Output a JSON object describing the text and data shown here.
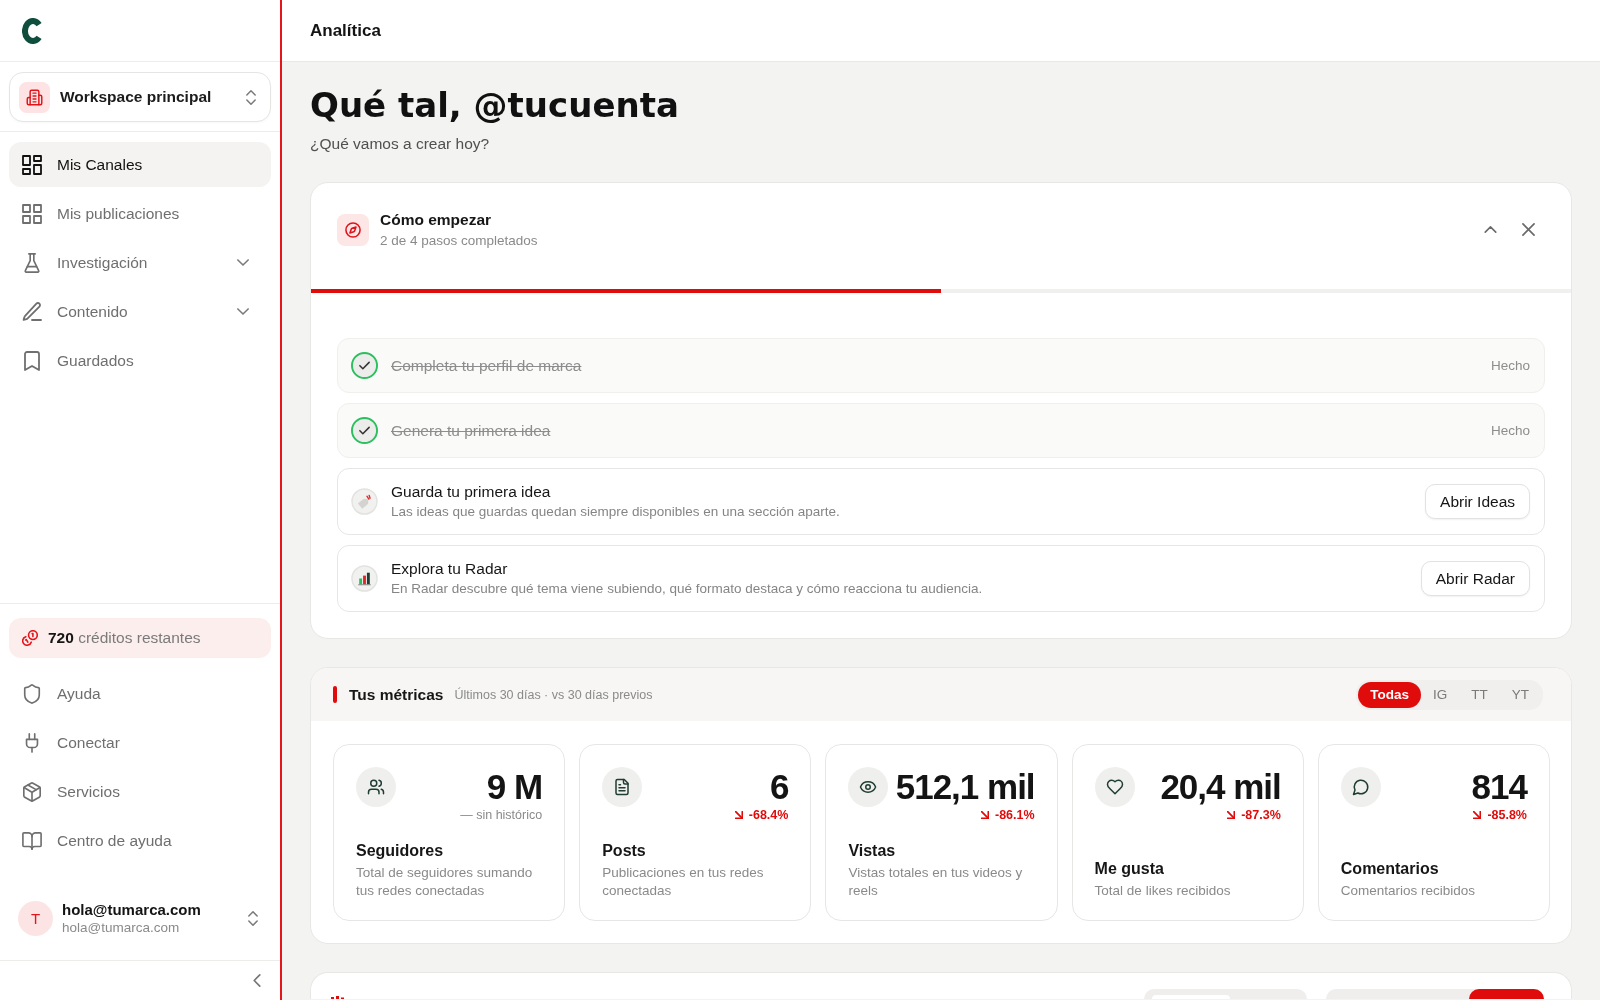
{
  "sidebar": {
    "workspace": {
      "name": "Workspace principal"
    },
    "nav": [
      {
        "label": "Mis Canales",
        "kind": "link",
        "selected": true
      },
      {
        "label": "Mis publicaciones",
        "kind": "link",
        "selected": false
      },
      {
        "label": "Investigación",
        "kind": "group",
        "selected": false,
        "expanded": false
      },
      {
        "label": "Contenido",
        "kind": "group",
        "selected": false,
        "expanded": false
      },
      {
        "label": "Guardados",
        "kind": "link",
        "selected": false
      }
    ],
    "credits": {
      "text": "**720** créditos restantes"
    },
    "footer_nav": [
      {
        "label": "Ayuda",
        "selected": false
      },
      {
        "label": "Conectar",
        "selected": false
      },
      {
        "label": "Servicios",
        "selected": false
      },
      {
        "label": "Centro de ayuda",
        "selected": false
      }
    ],
    "user": {
      "initial": "T",
      "name": "hola@tumarca.com",
      "email": "hola@tumarca.com"
    }
  },
  "header": {
    "title": "Analítica"
  },
  "greeting": {
    "title": "Qué tal, @tucuenta",
    "subtitle": "¿Qué vamos a crear hoy?"
  },
  "onboarding": {
    "title": "Cómo empezar",
    "progress_text": "2 de 4 pasos completados",
    "expanded": true,
    "level": 0.5,
    "steps": [
      {
        "title": "Completa tu perfil de marca",
        "done": true,
        "status": "Hecho"
      },
      {
        "title": "Genera tu primera idea",
        "done": true,
        "status": "Hecho"
      },
      {
        "title": "Guarda tu primera idea",
        "done": false,
        "description": "Las ideas que guardas quedan siempre disponibles en una sección aparte.",
        "action": "Abrir Ideas"
      },
      {
        "title": "Explora tu Radar",
        "done": false,
        "description": "En Radar descubre qué tema viene subiendo, qué formato destaca y cómo reacciona tu audiencia.",
        "action": "Abrir Radar"
      }
    ]
  },
  "metrics": {
    "title": "Tus métricas",
    "period": "Últimos 30 días · vs 30 días previos",
    "filters": [
      {
        "label": "Todas",
        "selected": true
      },
      {
        "label": "IG",
        "selected": false
      },
      {
        "label": "TT",
        "selected": false
      },
      {
        "label": "YT",
        "selected": false
      }
    ],
    "cards": [
      {
        "kind": "neutral",
        "value": "9 M",
        "change": "— sin histórico",
        "label": "Seguidores",
        "description": "Total de seguidores sumando tus redes conectadas"
      },
      {
        "kind": "decrease",
        "value": "6",
        "change": "-68.4%",
        "label": "Posts",
        "description": "Publicaciones en tus redes conectadas"
      },
      {
        "kind": "decrease",
        "value": "512,1 mil",
        "change": "-86.1%",
        "label": "Vistas",
        "description": "Vistas totales en tus videos y reels"
      },
      {
        "kind": "decrease",
        "value": "20,4 mil",
        "change": "-87.3%",
        "label": "Me gusta",
        "description": "Total de likes recibidos"
      },
      {
        "kind": "decrease",
        "value": "814",
        "change": "-85.8%",
        "label": "Comentarios",
        "description": "Comentarios recibidos"
      }
    ]
  }
}
